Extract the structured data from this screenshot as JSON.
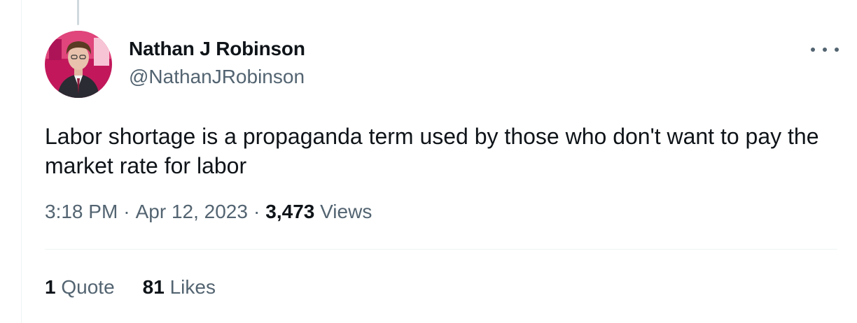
{
  "tweet": {
    "author": {
      "display_name": "Nathan J Robinson",
      "handle": "@NathanJRobinson"
    },
    "text": "Labor shortage is a propaganda term used by those who don't want to pay the market rate for labor",
    "time": "3:18 PM",
    "separator": "·",
    "date": "Apr 12, 2023",
    "views_count": "3,473",
    "views_label": "Views",
    "quotes_count": "1",
    "quotes_label": "Quote",
    "likes_count": "81",
    "likes_label": "Likes"
  },
  "icons": {
    "more": "more-horizontal-icon",
    "avatar": "avatar-photo"
  },
  "colors": {
    "text_primary": "#0f1419",
    "text_secondary": "#536471",
    "divider": "#eff3f4",
    "thread_line": "#cfd9de"
  }
}
